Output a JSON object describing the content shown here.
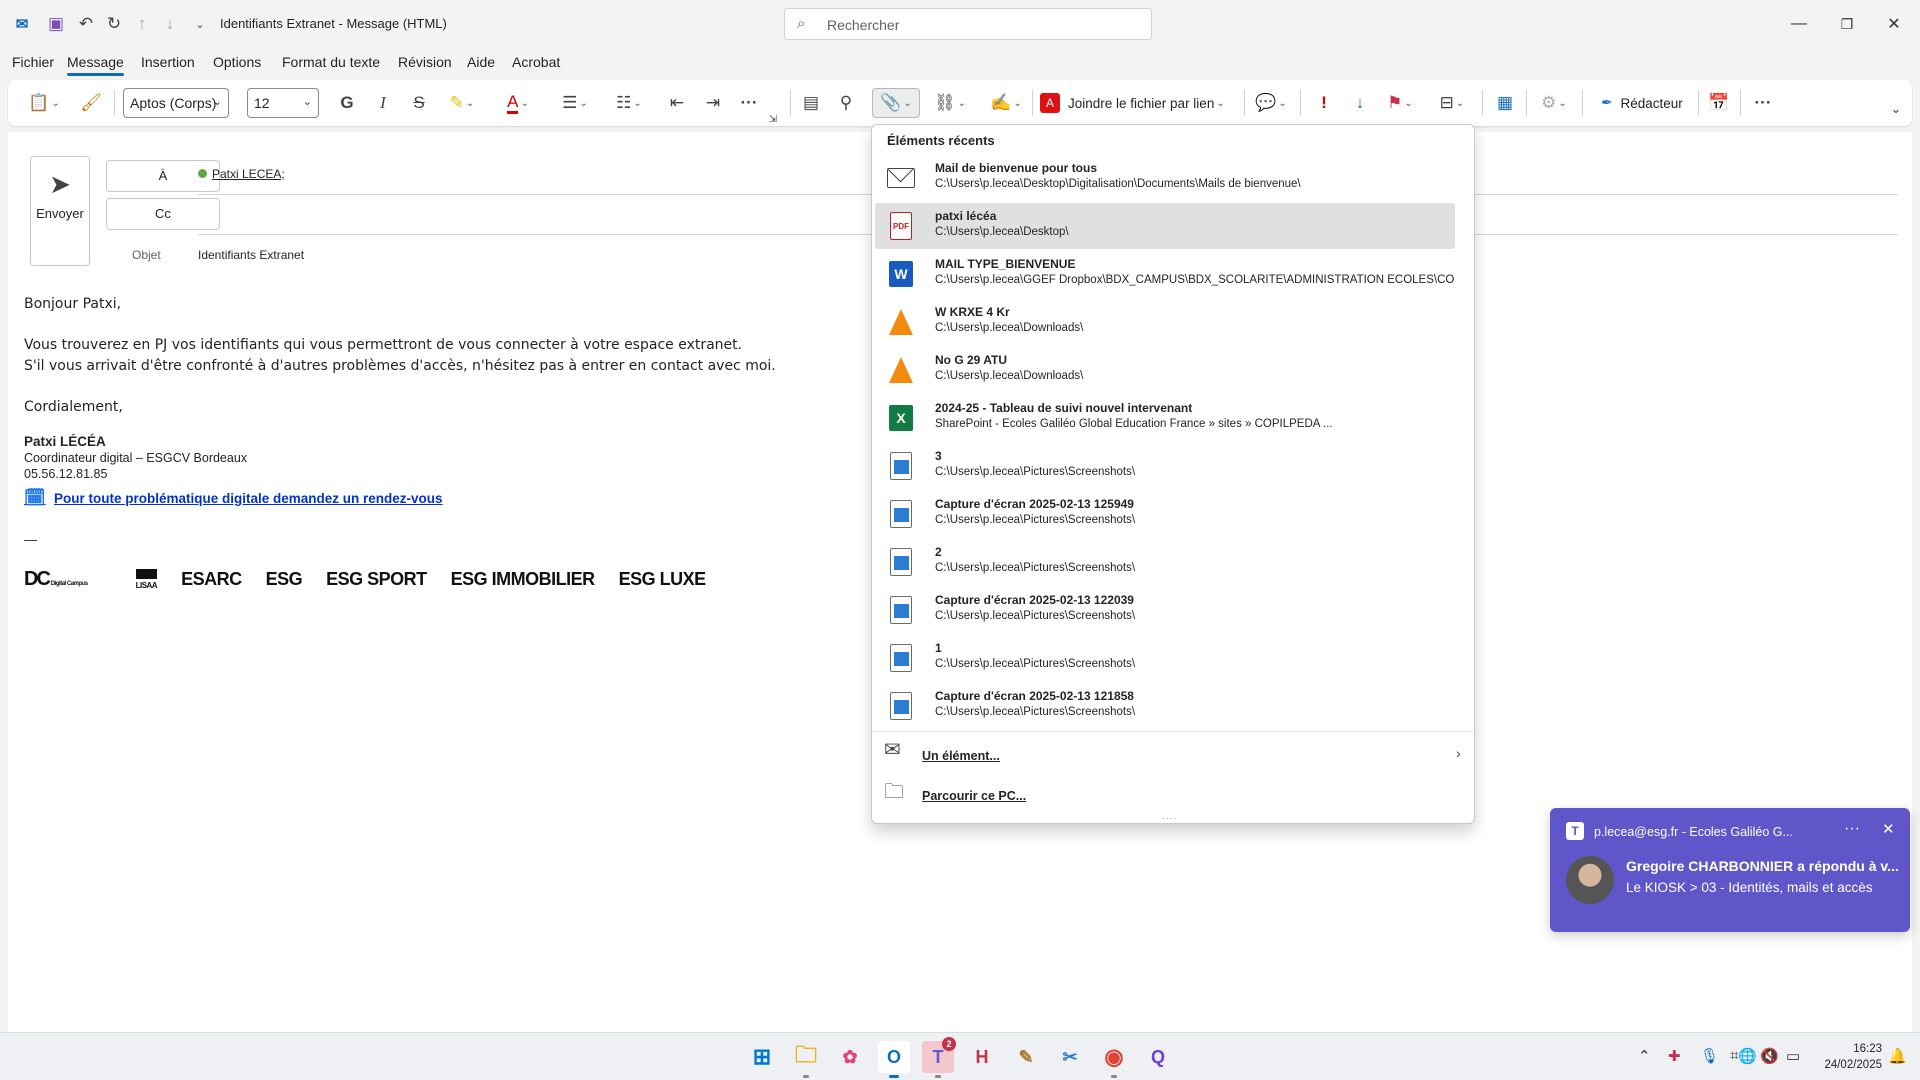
{
  "titlebar": {
    "doc_title": "Identifiants Extranet  -  Message (HTML)",
    "search_placeholder": "Rechercher"
  },
  "menu": [
    "Fichier",
    "Message",
    "Insertion",
    "Options",
    "Format du texte",
    "Révision",
    "Aide",
    "Acrobat"
  ],
  "ribbon": {
    "font_name": "Aptos (Corps)",
    "font_size": "12",
    "bold": "G",
    "italic": "I",
    "strike": "S",
    "adobe_attach": "Joindre le fichier par lien",
    "redacteur": "Rédacteur"
  },
  "compose": {
    "send_label": "Envoyer",
    "to_label": "À",
    "cc_label": "Cc",
    "to_recipient": "Patxi LECEA;",
    "subject_label": "Objet",
    "subject_value": "Identifiants Extranet",
    "body": {
      "greeting": "Bonjour Patxi,",
      "line1": "Vous trouverez en PJ vos identifiants qui vous permettront de vous connecter à votre espace extranet.",
      "line2": "S'il vous arrivait d'être confronté à d'autres problèmes d'accès, n'hésitez pas à entrer en contact avec moi.",
      "closing": "Cordialement,"
    },
    "signature": {
      "name": "Patxi LÉCÉA",
      "role": "Coordinateur digital – ESGCV Bordeaux",
      "phone": "05.56.12.81.85",
      "link": "Pour toute problématique digitale demandez un rendez-vous",
      "dash": "—",
      "logos": [
        "Digital Campus",
        "LISAA",
        "ESARC",
        "ESG",
        "ESG SPORT",
        "ESG IMMOBILIER",
        "ESG LUXE"
      ]
    }
  },
  "recent": {
    "title": "Éléments récents",
    "items": [
      {
        "name": "Mail de bienvenue pour tous",
        "path": "C:\\Users\\p.lecea\\Desktop\\Digitalisation\\Documents\\Mails de bienvenue\\",
        "icon": "mail-icon"
      },
      {
        "name": "patxi lécéa",
        "path": "C:\\Users\\p.lecea\\Desktop\\",
        "icon": "pdf-icon"
      },
      {
        "name": "MAIL TYPE_BIENVENUE",
        "path": "C:\\Users\\p.lecea\\GGEF Dropbox\\BDX_CAMPUS\\BDX_SCOLARITE\\ADMINISTRATION ECOLES\\CO...",
        "icon": "word-icon"
      },
      {
        "name": "W KRXE 4 Kr",
        "path": "C:\\Users\\p.lecea\\Downloads\\",
        "icon": "vlc-icon"
      },
      {
        "name": "No G 29 ATU",
        "path": "C:\\Users\\p.lecea\\Downloads\\",
        "icon": "vlc-icon"
      },
      {
        "name": "2024-25 - Tableau de suivi nouvel intervenant",
        "path": "SharePoint - Ecoles Galiléo Global Education France » sites » COPILPEDA ...",
        "icon": "excel-icon"
      },
      {
        "name": "3",
        "path": "C:\\Users\\p.lecea\\Pictures\\Screenshots\\",
        "icon": "image-icon"
      },
      {
        "name": "Capture d'écran 2025-02-13 125949",
        "path": "C:\\Users\\p.lecea\\Pictures\\Screenshots\\",
        "icon": "image-icon"
      },
      {
        "name": "2",
        "path": "C:\\Users\\p.lecea\\Pictures\\Screenshots\\",
        "icon": "image-icon"
      },
      {
        "name": "Capture d'écran 2025-02-13 122039",
        "path": "C:\\Users\\p.lecea\\Pictures\\Screenshots\\",
        "icon": "image-icon"
      },
      {
        "name": "1",
        "path": "C:\\Users\\p.lecea\\Pictures\\Screenshots\\",
        "icon": "image-icon"
      },
      {
        "name": "Capture d'écran 2025-02-13 121858",
        "path": "C:\\Users\\p.lecea\\Pictures\\Screenshots\\",
        "icon": "image-icon"
      }
    ],
    "action_item": "Un élément...",
    "action_browse": "Parcourir ce PC..."
  },
  "toast": {
    "app": "p.lecea@esg.fr - Ecoles Galiléo G...",
    "title": "Gregoire CHARBONNIER a répondu à v...",
    "text": "Le KIOSK > 03 - Identités, mails et accès"
  },
  "taskbar": {
    "teams_badge": "2",
    "time": "16:23",
    "date": "24/02/2025"
  },
  "colors": {
    "accent": "#0f6cbd",
    "toast_bg": "#5f56c9",
    "link": "#0033cc"
  }
}
